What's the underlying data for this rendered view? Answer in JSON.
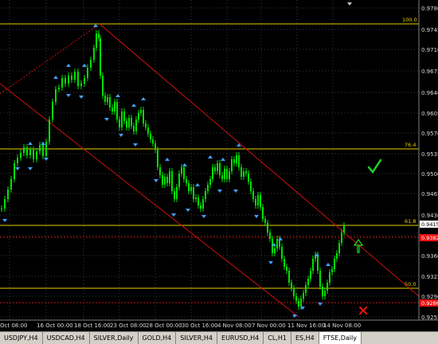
{
  "price_axis": {
    "labels": [
      "0.9780",
      "0.9745",
      "0.9710",
      "0.9675",
      "0.9640",
      "0.9605",
      "0.9570",
      "0.9535",
      "0.9500",
      "0.9465",
      "0.9430",
      "0.9395",
      "0.9360",
      "0.9325",
      "0.9290",
      "0.9255"
    ],
    "current_price": "0.9415",
    "red_tag_upper": "0.9382",
    "red_tag_lower": "0.9286"
  },
  "time_axis": {
    "labels": [
      "Oct 08:00",
      "16 Oct 00:00",
      "18 Oct 16:00",
      "23 Oct 08:00",
      "28 Oct 00:00",
      "30 Oct 16:00",
      "4 Nov 08:00",
      "7 Nov 00:00",
      "11 Nov 16:00",
      "14 Nov 08:00"
    ]
  },
  "fibo": {
    "level_100": "100.0",
    "level_76": "76.4",
    "level_61": "61.8",
    "level_50": "50.0"
  },
  "colors": {
    "background": "#000000",
    "grid": "#3a3a3a",
    "candles": "#00e000",
    "fib_lines": "#e8d000",
    "channel": "#cc1010",
    "arrows": "#40a0ff",
    "current_price_tag": "#ffffff"
  },
  "markers": {
    "check_icon": "checkmark-icon",
    "up_arrow_icon": "up-arrow-icon",
    "x_icon": "x-cross-icon"
  },
  "tabs": [
    "USDJPY,H4",
    "USDCAD,H4",
    "SILVER,Daily",
    "GOLD,H4",
    "SILVER,H4",
    "EURUSD,H4",
    "CL,H1",
    "ES,H4",
    "FTSE,Daily"
  ],
  "active_tab": "FTSE,Daily"
}
